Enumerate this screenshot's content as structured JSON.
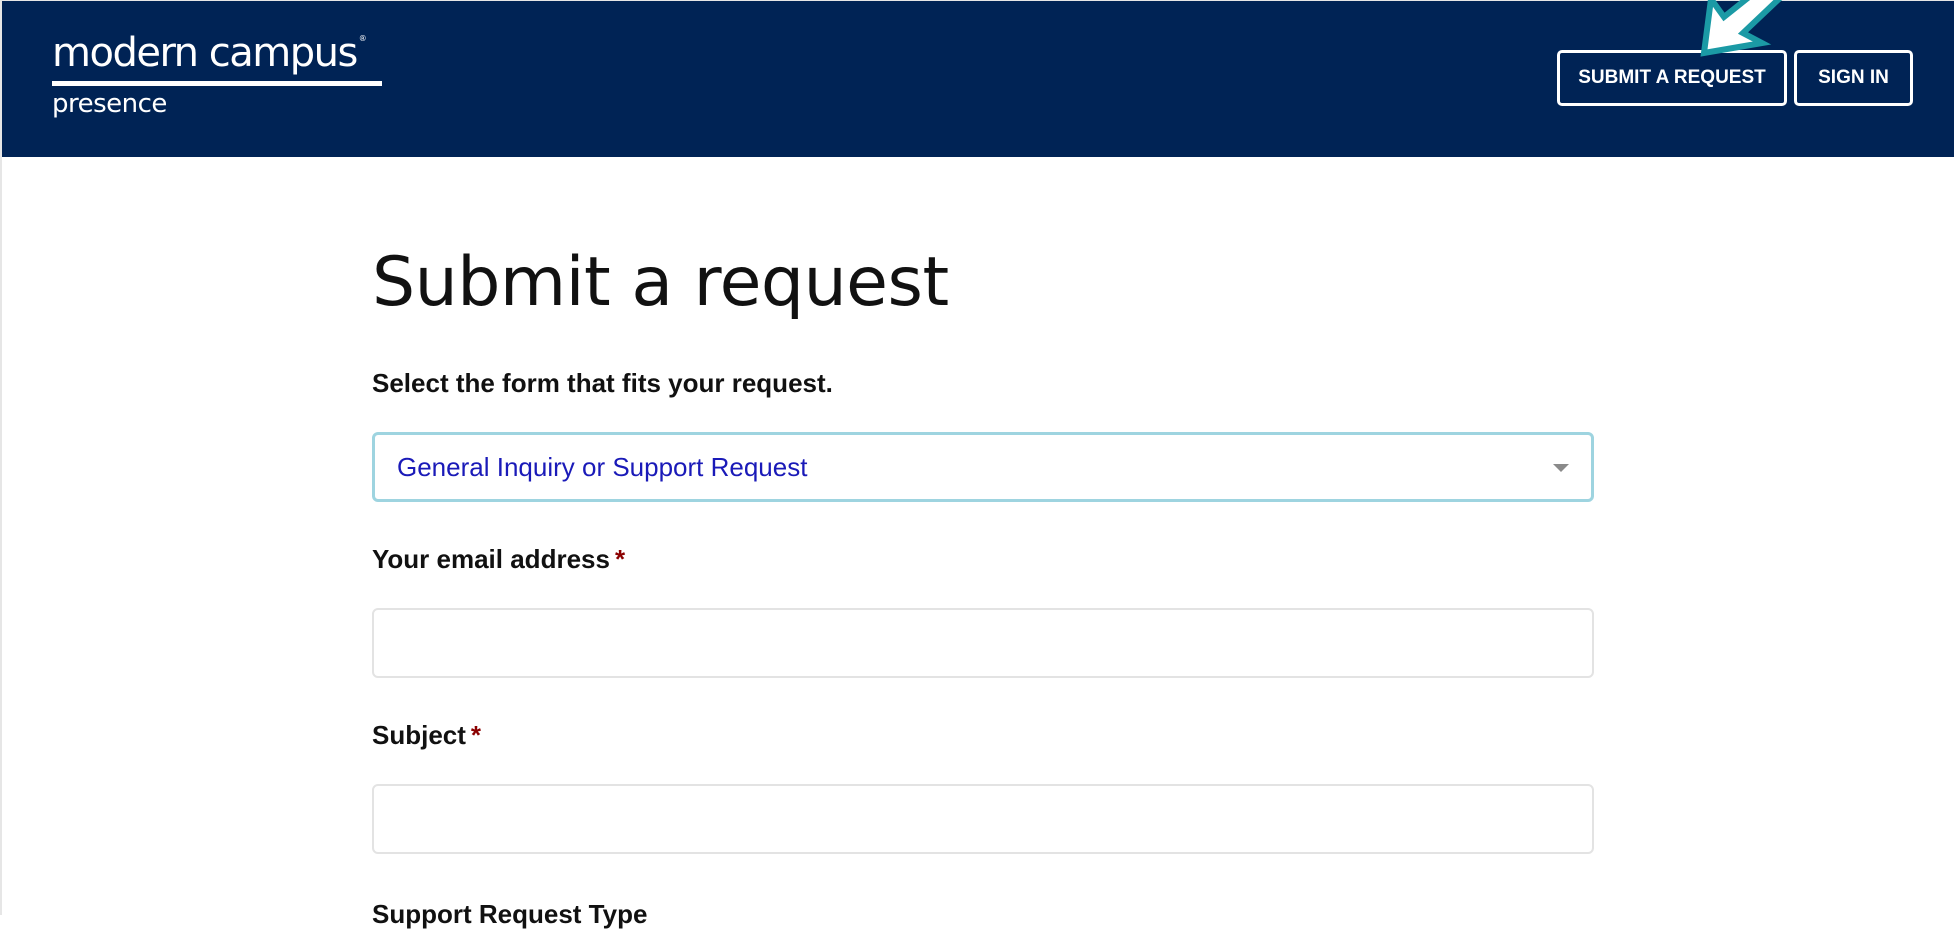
{
  "brand": {
    "name": "modern campus",
    "trademark": "®",
    "product": "presence"
  },
  "nav": {
    "submit_request": "SUBMIT A REQUEST",
    "sign_in": "SIGN IN"
  },
  "page": {
    "title": "Submit a request"
  },
  "form": {
    "form_select": {
      "label": "Select the form that fits your request.",
      "value": "General Inquiry or Support Request"
    },
    "email": {
      "label": "Your email address",
      "required_marker": "*",
      "value": ""
    },
    "subject": {
      "label": "Subject",
      "required_marker": "*",
      "value": ""
    },
    "support_request_type": {
      "label": "Support Request Type"
    }
  },
  "colors": {
    "header_bg": "#002355",
    "select_border": "#9ed4e0",
    "select_text": "#1a1ab8",
    "required": "#8b0000",
    "pointer_arrow": "#1b9aa5"
  },
  "icons": {
    "select_caret": "chevron-down-icon",
    "annotation_arrow": "pointer-arrow-icon"
  }
}
